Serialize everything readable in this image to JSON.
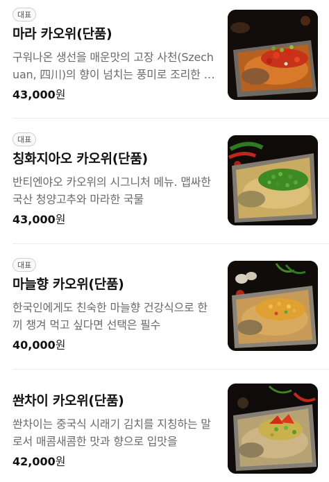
{
  "menu": {
    "items": [
      {
        "badge": "대표",
        "name": "마라 카오위(단품)",
        "description": "구워나온 생선을 매운맛의 고장 사천(Szechuan, 四川)의 향이 넘치는 풍미로 조리한 요리",
        "price": "43,000",
        "currency": "원",
        "image": "mala-grilled-fish-photo"
      },
      {
        "badge": "대표",
        "name": "칭화지아오 카오위(단품)",
        "description": "반티엔야오 카오위의 시그니처 메뉴. 맵싸한 국산 청양고추와 마라한 국물",
        "price": "43,000",
        "currency": "원",
        "image": "green-pepper-grilled-fish-photo"
      },
      {
        "badge": "대표",
        "name": "마늘향 카오위(단품)",
        "description": "한국인에게도 친숙한 마늘향 건강식으로 한끼 챙겨 먹고 싶다면 선택은 필수",
        "price": "40,000",
        "currency": "원",
        "image": "garlic-grilled-fish-photo"
      },
      {
        "badge": "",
        "name": "쏸차이 카오위(단품)",
        "description": "쏸차이는 중국식 시래기 김치를 지칭하는 말로서 매콤새콤한 맛과 향으로 입맛을",
        "price": "42,000",
        "currency": "원",
        "image": "suancai-grilled-fish-photo"
      }
    ]
  }
}
